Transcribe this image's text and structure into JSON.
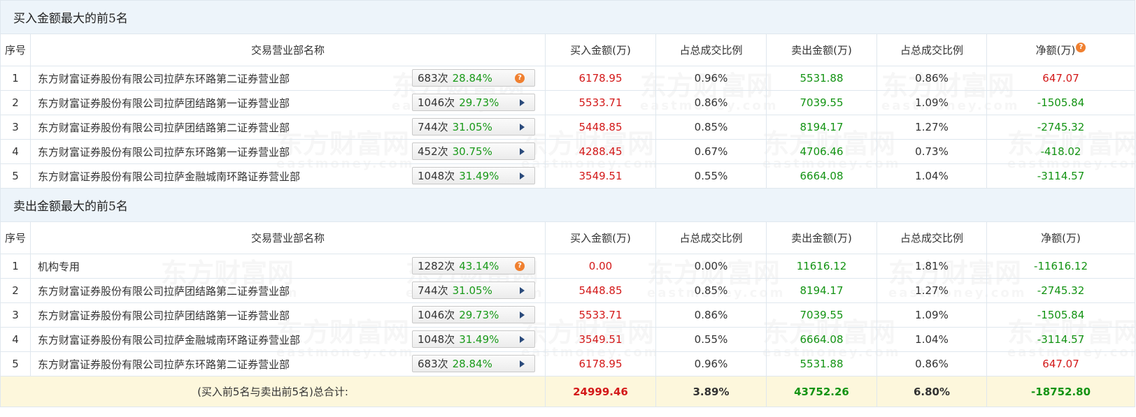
{
  "watermark": {
    "cn": "东方财富网",
    "en": "eastmoney.com"
  },
  "colors": {
    "buy": "#d31919",
    "sell": "#139313",
    "section_bg": "#edf4fa",
    "total_bg": "#fdf7dc"
  },
  "columns": [
    "序号",
    "交易营业部名称",
    "买入金额(万)",
    "占总成交比例",
    "卖出金额(万)",
    "占总成交比例",
    "净额(万)"
  ],
  "buy_top5": {
    "title": "买入金额最大的前5名",
    "rows": [
      {
        "no": "1",
        "name": "东方财富证券股份有限公司拉萨东环路第二证券营业部",
        "count": "683次",
        "rate": "28.84%",
        "badge_icon": "question-icon",
        "buy": "6178.95",
        "buy_ratio": "0.96%",
        "sell": "5531.88",
        "sell_ratio": "0.86%",
        "net": "647.07",
        "net_sign": "pos"
      },
      {
        "no": "2",
        "name": "东方财富证券股份有限公司拉萨团结路第一证券营业部",
        "count": "1046次",
        "rate": "29.73%",
        "badge_icon": "play-icon",
        "buy": "5533.71",
        "buy_ratio": "0.86%",
        "sell": "7039.55",
        "sell_ratio": "1.09%",
        "net": "-1505.84",
        "net_sign": "neg"
      },
      {
        "no": "3",
        "name": "东方财富证券股份有限公司拉萨团结路第二证券营业部",
        "count": "744次",
        "rate": "31.05%",
        "badge_icon": "play-icon",
        "buy": "5448.85",
        "buy_ratio": "0.85%",
        "sell": "8194.17",
        "sell_ratio": "1.27%",
        "net": "-2745.32",
        "net_sign": "neg"
      },
      {
        "no": "4",
        "name": "东方财富证券股份有限公司拉萨东环路第一证券营业部",
        "count": "452次",
        "rate": "30.75%",
        "badge_icon": "play-icon",
        "buy": "4288.45",
        "buy_ratio": "0.67%",
        "sell": "4706.46",
        "sell_ratio": "0.73%",
        "net": "-418.02",
        "net_sign": "neg"
      },
      {
        "no": "5",
        "name": "东方财富证券股份有限公司拉萨金融城南环路证券营业部",
        "count": "1048次",
        "rate": "31.49%",
        "badge_icon": "play-icon",
        "buy": "3549.51",
        "buy_ratio": "0.55%",
        "sell": "6664.08",
        "sell_ratio": "1.04%",
        "net": "-3114.57",
        "net_sign": "neg"
      }
    ]
  },
  "sell_top5": {
    "title": "卖出金额最大的前5名",
    "rows": [
      {
        "no": "1",
        "name": "机构专用",
        "count": "1282次",
        "rate": "43.14%",
        "badge_icon": "question-icon",
        "buy": "0.00",
        "buy_ratio": "0.00%",
        "sell": "11616.12",
        "sell_ratio": "1.81%",
        "net": "-11616.12",
        "net_sign": "neg"
      },
      {
        "no": "2",
        "name": "东方财富证券股份有限公司拉萨团结路第二证券营业部",
        "count": "744次",
        "rate": "31.05%",
        "badge_icon": "play-icon",
        "buy": "5448.85",
        "buy_ratio": "0.85%",
        "sell": "8194.17",
        "sell_ratio": "1.27%",
        "net": "-2745.32",
        "net_sign": "neg"
      },
      {
        "no": "3",
        "name": "东方财富证券股份有限公司拉萨团结路第一证券营业部",
        "count": "1046次",
        "rate": "29.73%",
        "badge_icon": "play-icon",
        "buy": "5533.71",
        "buy_ratio": "0.86%",
        "sell": "7039.55",
        "sell_ratio": "1.09%",
        "net": "-1505.84",
        "net_sign": "neg"
      },
      {
        "no": "4",
        "name": "东方财富证券股份有限公司拉萨金融城南环路证券营业部",
        "count": "1048次",
        "rate": "31.49%",
        "badge_icon": "play-icon",
        "buy": "3549.51",
        "buy_ratio": "0.55%",
        "sell": "6664.08",
        "sell_ratio": "1.04%",
        "net": "-3114.57",
        "net_sign": "neg"
      },
      {
        "no": "5",
        "name": "东方财富证券股份有限公司拉萨东环路第二证券营业部",
        "count": "683次",
        "rate": "28.84%",
        "badge_icon": "play-icon",
        "buy": "6178.95",
        "buy_ratio": "0.96%",
        "sell": "5531.88",
        "sell_ratio": "0.86%",
        "net": "647.07",
        "net_sign": "pos"
      }
    ]
  },
  "total": {
    "label": "(买入前5名与卖出前5名)总合计:",
    "buy": "24999.46",
    "buy_ratio": "3.89%",
    "sell": "43752.26",
    "sell_ratio": "6.80%",
    "net": "-18752.80"
  }
}
